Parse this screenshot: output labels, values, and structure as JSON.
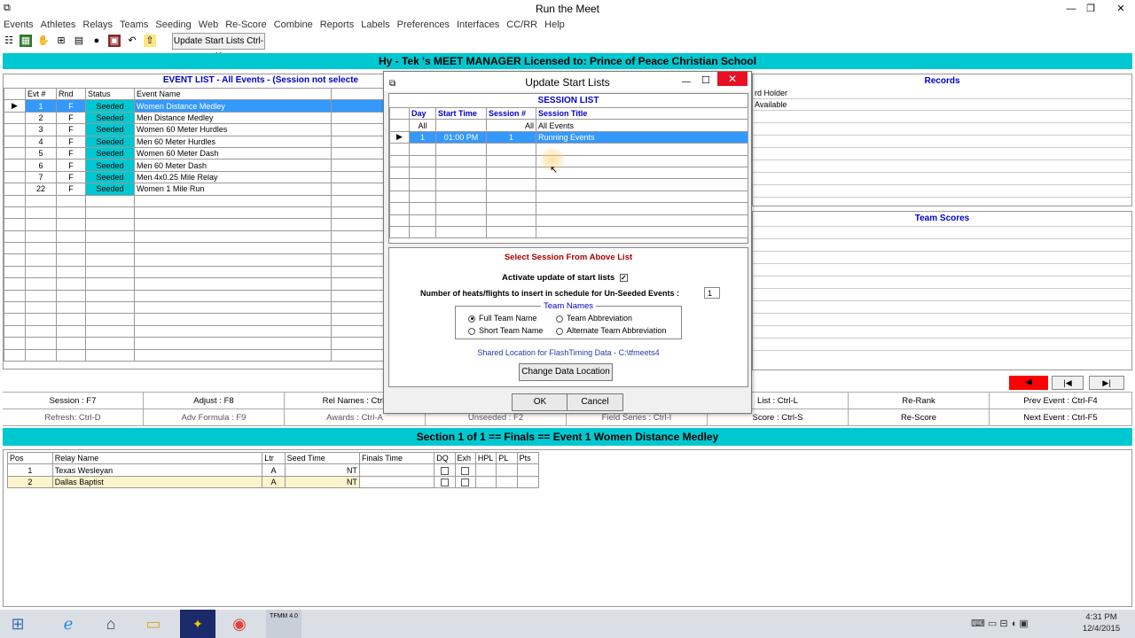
{
  "window": {
    "title": "Run the Meet",
    "minimize": "—",
    "maximize": "❐",
    "close": "✕"
  },
  "menu": [
    "Events",
    "Athletes",
    "Relays",
    "Teams",
    "Seeding",
    "Web",
    "Re-Score",
    "Combine",
    "Reports",
    "Labels",
    "Preferences",
    "Interfaces",
    "CC/RR",
    "Help"
  ],
  "toolbar": {
    "update_label": "Update Start Lists Ctrl-U"
  },
  "license": "Hy - Tek 's MEET MANAGER Licensed to:  Prince of Peace Christian School",
  "event_list": {
    "title": "EVENT LIST - All Events - (Session not selecte",
    "columns": [
      "Evt #",
      "Rnd",
      "Status",
      "Event Name"
    ],
    "rows": [
      {
        "evt": "1",
        "rnd": "F",
        "status": "Seeded",
        "name": "Women Distance Medley"
      },
      {
        "evt": "2",
        "rnd": "F",
        "status": "Seeded",
        "name": "Men Distance Medley"
      },
      {
        "evt": "3",
        "rnd": "F",
        "status": "Seeded",
        "name": "Women 60 Meter Hurdles"
      },
      {
        "evt": "4",
        "rnd": "F",
        "status": "Seeded",
        "name": "Men 60 Meter Hurdles"
      },
      {
        "evt": "5",
        "rnd": "F",
        "status": "Seeded",
        "name": "Women 60 Meter Dash"
      },
      {
        "evt": "6",
        "rnd": "F",
        "status": "Seeded",
        "name": "Men 60 Meter Dash"
      },
      {
        "evt": "7",
        "rnd": "F",
        "status": "Seeded",
        "name": "Men 4x0.25 Mile Relay"
      },
      {
        "evt": "22",
        "rnd": "F",
        "status": "Seeded",
        "name": "Women 1 Mile Run"
      }
    ]
  },
  "records": {
    "title": "Records",
    "line1": "rd Holder",
    "line2": "Available"
  },
  "team_scores": {
    "title": "Team Scores"
  },
  "fkeys": {
    "session": "Session : F7",
    "adjust": "Adjust : F8",
    "rel_names": "Rel Names : Ctrl-",
    "refresh": "Refresh: Ctrl-D",
    "adv_formula": "Adv Formula : F9",
    "awards": "Awards : Ctrl-A",
    "unseeded": "Unseeded : F2",
    "field_series": "Field Series : Ctrl-I",
    "list": "List : Ctrl-L",
    "re_rank": "Re-Rank",
    "prev_event": "Prev Event : Ctrl-F4",
    "score": "Score : Ctrl-S",
    "re_score": "Re-Score",
    "next_event": "Next Event : Ctrl-F5"
  },
  "nav": {
    "first": "◀",
    "prev": "|◀",
    "next": "▶|"
  },
  "section_bar": "Section  1  of  1  ==  Finals  ==  Event 1  Women Distance Medley",
  "relay_table": {
    "columns": [
      "Pos",
      "Relay Name",
      "Ltr",
      "Seed Time",
      "Finals Time",
      "DQ",
      "Exh",
      "HPL",
      "PL",
      "Pts"
    ],
    "rows": [
      {
        "pos": "1",
        "name": "Texas Wesleyan",
        "ltr": "A",
        "seed": "NT"
      },
      {
        "pos": "2",
        "name": "Dallas Baptist",
        "ltr": "A",
        "seed": "NT"
      }
    ]
  },
  "dialog": {
    "title": "Update Start Lists",
    "close": "✕",
    "max": "☐",
    "min": "—",
    "session_list_title": "SESSION LIST",
    "columns": [
      "Day",
      "Start Time",
      "Session #",
      "Session Title"
    ],
    "all_row": {
      "day": "All",
      "time": "",
      "num": "All",
      "title": "All Events"
    },
    "sessions": [
      {
        "day": "1",
        "time": "01:00 PM",
        "num": "1",
        "title": "Running Events"
      }
    ],
    "select_prompt": "Select Session From Above List",
    "activate_label": "Activate update of start lists",
    "activate_checked": "✓",
    "heats_label": "Number of heats/flights to insert in schedule for Un-Seeded Events :",
    "heats_value": "1",
    "team_names_title": "Team Names",
    "opt_full": "Full Team Name",
    "opt_abbrev": "Team Abbreviation",
    "opt_short": "Short Team Name",
    "opt_alt": "Alternate Team Abbreviation",
    "shared_location": "Shared Location for FlashTiming Data  -  C:\\tfmeets4",
    "change_button": "Change Data Location",
    "ok": "OK",
    "cancel": "Cancel"
  },
  "taskbar": {
    "time": "4:31 PM",
    "date": "12/4/2015",
    "tfmm_label": "TFMM 4.0"
  }
}
